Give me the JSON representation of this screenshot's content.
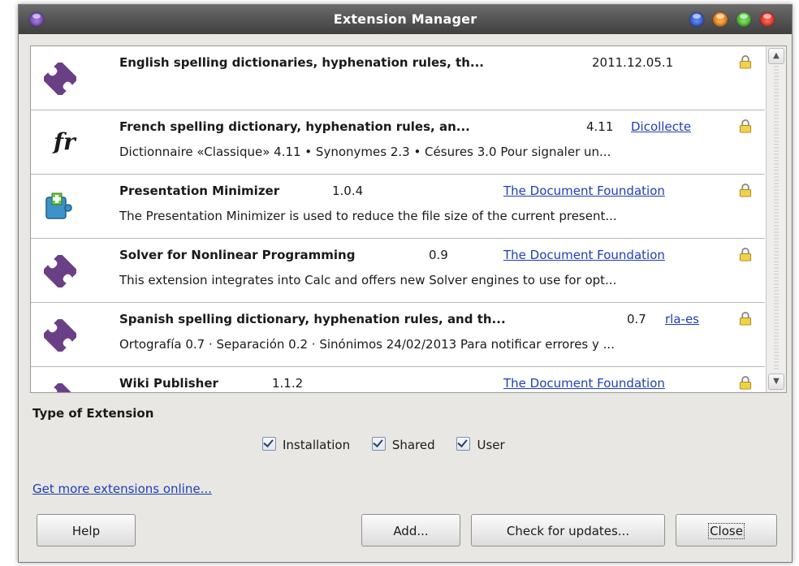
{
  "window": {
    "title": "Extension Manager"
  },
  "extensions": [
    {
      "name": "English spelling dictionaries, hyphenation rules, th...",
      "version": "2011.12.05.1",
      "publisher": "",
      "description": "",
      "icon": "puzzle-icon"
    },
    {
      "name": "French spelling dictionary, hyphenation rules, an...",
      "version": "4.11",
      "publisher": "Dicollecte",
      "description": "Dictionnaire «Classique» 4.11 • Synonymes 2.3 • Césures 3.0  Pour signaler un...",
      "icon": "fr-icon",
      "icon_text": "fr"
    },
    {
      "name": "Presentation Minimizer",
      "version": "1.0.4",
      "publisher": "The Document Foundation",
      "description": "The Presentation Minimizer is used to reduce the file size of the current present...",
      "icon": "puzzle-plus-icon"
    },
    {
      "name": "Solver for Nonlinear Programming",
      "version": "0.9",
      "publisher": "The Document Foundation",
      "description": "This extension integrates into Calc and offers new Solver engines to use for opt...",
      "icon": "puzzle-icon"
    },
    {
      "name": "Spanish spelling dictionary, hyphenation rules, and th...",
      "version": "0.7",
      "publisher": "rla-es",
      "description": "Ortografía 0.7 · Separación 0.2 · Sinónimos 24/02/2013   Para notificar errores y ...",
      "icon": "puzzle-icon"
    },
    {
      "name": "Wiki Publisher",
      "version": "1.1.2",
      "publisher": "The Document Foundation",
      "description": "",
      "icon": "puzzle-icon"
    }
  ],
  "filters": {
    "label": "Type of Extension",
    "options": [
      {
        "label": "Installation",
        "checked": true
      },
      {
        "label": "Shared",
        "checked": true
      },
      {
        "label": "User",
        "checked": true
      }
    ]
  },
  "get_more_link": "Get more extensions online...",
  "buttons": {
    "help": "Help",
    "add": "Add...",
    "check_updates": "Check for updates...",
    "close": "Close"
  },
  "colors": {
    "link": "#1c3fb8",
    "puzzle": "#6b3f86",
    "titlebar": "#4a4a4a"
  }
}
